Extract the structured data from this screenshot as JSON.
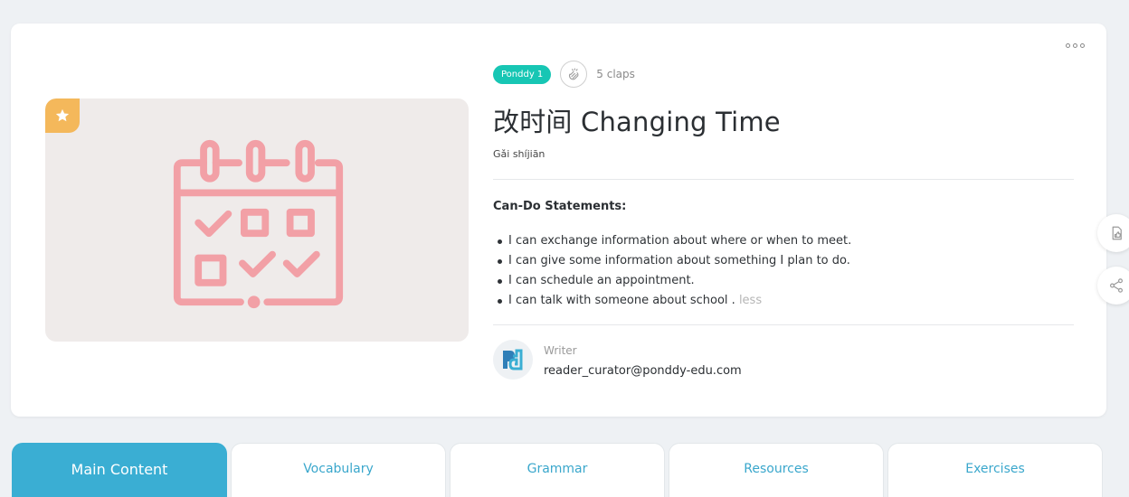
{
  "lesson": {
    "level": "Ponddy 1",
    "claps": "5 claps",
    "title": "改时间 Changing Time",
    "pinyin": "Gǎi shíjiān",
    "cando_title": "Can-Do Statements:",
    "cando_items": [
      "I can exchange information about where or when to meet.",
      "I can give some information about something I plan to do.",
      "I can schedule an appointment.",
      "I can talk with someone about school ."
    ],
    "less_label": "less",
    "writer_label": "Writer",
    "writer_email": "reader_curator@ponddy-edu.com"
  },
  "icons": {
    "cover": "calendar-icon",
    "badge": "star-icon",
    "clap": "clap-icon",
    "more": "more-icon",
    "side_1": "clipboard-like-icon",
    "side_2": "share-icon"
  },
  "colors": {
    "level_pill": "#17c6b4",
    "calendar": "#f2a0a6",
    "star_badge": "#f4b85b",
    "active_tab": "#3aaed3",
    "tab_text": "#3aa7cc"
  },
  "tabs": [
    {
      "label": "Main Content",
      "active": true
    },
    {
      "label": "Vocabulary",
      "active": false
    },
    {
      "label": "Grammar",
      "active": false
    },
    {
      "label": "Resources",
      "active": false
    },
    {
      "label": "Exercises",
      "active": false
    }
  ]
}
